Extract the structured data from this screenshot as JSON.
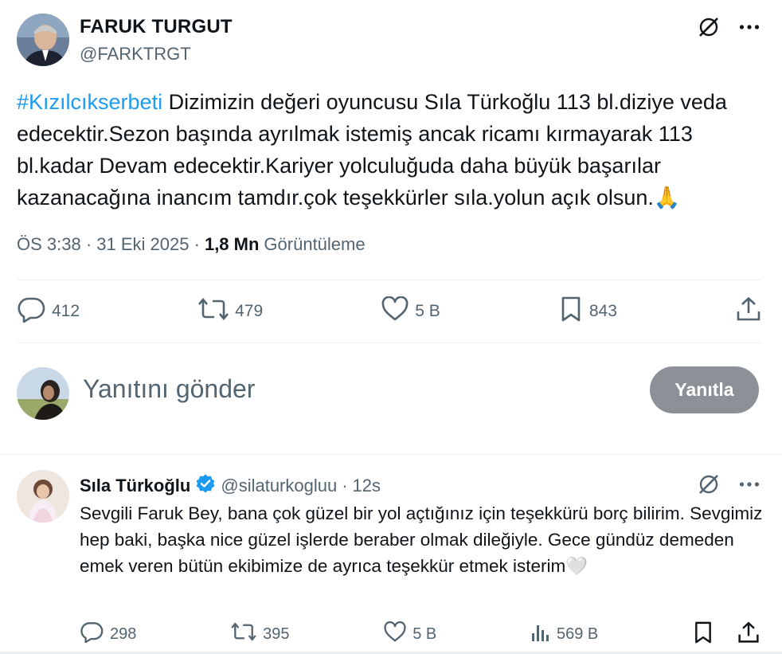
{
  "tweet": {
    "author_name": "FARUK TURGUT",
    "author_handle": "@FARKTRGT",
    "hashtag": "#Kızılcıkserbeti",
    "text": " Dizimizin değeri oyuncusu Sıla Türkoğlu 113 bl.diziye veda edecektir.Sezon başında ayrılmak istemiş ancak ricamı kırmayarak 113 bl.kadar Devam edecektir.Kariyer yolculuğuda daha büyük başarılar kazanacağına inancım tamdır.çok teşekkürler sıla.yolun açık olsun.",
    "emoji": "🙏",
    "time": "ÖS 3:38",
    "date": "31 Eki 2025",
    "separator": "·",
    "views_count": "1,8 Mn",
    "views_label": "Görüntüleme",
    "stats": {
      "replies": "412",
      "reposts": "479",
      "likes": "5 B",
      "bookmarks": "843"
    }
  },
  "composer": {
    "placeholder": "Yanıtını gönder",
    "button_label": "Yanıtla"
  },
  "reply": {
    "author_name": "Sıla Türkoğlu",
    "author_handle": "@silaturkogluu",
    "separator": "·",
    "time": "12s",
    "text": "Sevgili Faruk Bey, bana çok güzel bir yol açtığınız için teşekkürü borç bilirim. Sevgimiz hep baki, başka nice güzel işlerde beraber olmak dileğiyle. Gece gündüz demeden emek veren bütün ekibimize de ayrıca teşekkür etmek isterim",
    "emoji": "🤍",
    "stats": {
      "replies": "298",
      "reposts": "395",
      "likes": "5 B",
      "views": "569 B"
    }
  },
  "colors": {
    "accent": "#1d9bf0",
    "secondary_text": "#536471",
    "primary_text": "#0f1419",
    "disabled_button": "#8b9197",
    "verified": "#1d9bf0"
  },
  "icons": {
    "grok": "grok-icon",
    "more": "more-icon",
    "reply": "reply-icon",
    "repost": "repost-icon",
    "like": "like-icon",
    "bookmark": "bookmark-icon",
    "share": "share-icon",
    "views": "views-icon",
    "verified": "verified-badge-icon"
  }
}
